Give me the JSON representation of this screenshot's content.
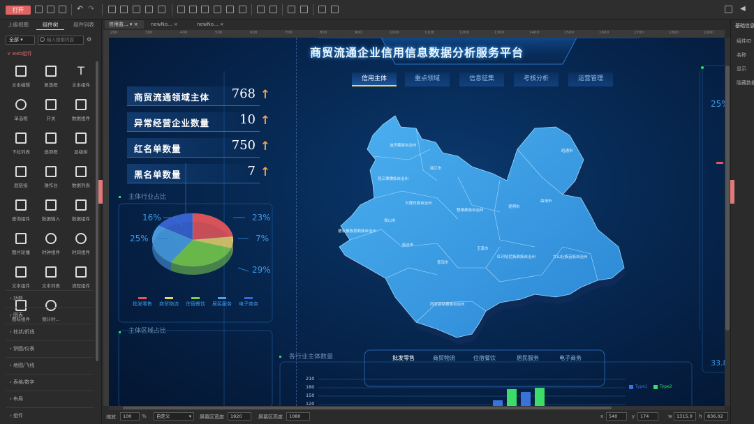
{
  "toolbar": {
    "open_label": "打开"
  },
  "left_panel": {
    "tabs": [
      "上级视图",
      "组件树",
      "组件列表"
    ],
    "filter_select": "全部",
    "search_placeholder": "输入搜索内容",
    "group_title": "web组件",
    "widgets": [
      "文本编辑",
      "复选框",
      "文本组件",
      "单选框",
      "开关",
      "数据组件",
      "下拉列表",
      "选项框",
      "层级树",
      "超链接",
      "操作台",
      "数据列表",
      "查询组件",
      "数据输入",
      "数据组件",
      "图片轮播",
      "时钟组件",
      "时间组件",
      "文本组件",
      "文本列表",
      "流程组件",
      "图标组件",
      "倒计时..."
    ],
    "categories": [
      "功能",
      "图表",
      "柱状/折线",
      "饼图/仪表",
      "地图/飞线",
      "表格/数字",
      "布局",
      "组件"
    ]
  },
  "doc_tabs": [
    "信用监...",
    "newNo...",
    "newNo..."
  ],
  "ruler_ticks": [
    "200",
    "300",
    "400",
    "500",
    "600",
    "700",
    "800",
    "900",
    "1000",
    "1100",
    "1200",
    "1300",
    "1400",
    "1500",
    "1600",
    "1700",
    "1800",
    "1900"
  ],
  "right_panel": {
    "title": "基础信息",
    "items": [
      "组件ID",
      "名称",
      "显示",
      "隐藏数据"
    ]
  },
  "dashboard": {
    "title": "商贸流通企业信用信息数据分析服务平台",
    "nav": [
      "信用主体",
      "重点领域",
      "信息征集",
      "考核分析",
      "运营管理"
    ],
    "kpis": [
      {
        "label": "商贸流通领域主体",
        "value": "768"
      },
      {
        "label": "异常经营企业数量",
        "value": "10"
      },
      {
        "label": "红名单数量",
        "value": "750"
      },
      {
        "label": "黑名单数量",
        "value": "7"
      }
    ],
    "kpi_arrow": "↑",
    "pie_section_title": "主体行业占比",
    "pie_labels": [
      "16%",
      "23%",
      "25%",
      "7%",
      "29%"
    ],
    "legend": [
      "批发零售",
      "商贸物流",
      "住宿餐饮",
      "居民服务",
      "电子商务"
    ],
    "lower_section_title": "主体区域占比",
    "bottom_section_title": "各行业主体数量",
    "bottom_tabs": [
      "批发零售",
      "商贸物流",
      "住宿餐饮",
      "居民服务",
      "电子商务"
    ],
    "y_ticks": [
      "210",
      "180",
      "150",
      "120"
    ],
    "bar_legend": [
      "Type1",
      "Type2"
    ],
    "right_values": [
      "25%",
      "33.8"
    ],
    "cities": [
      "迪庆藏族自治州",
      "丽江市",
      "怒江傈僳族自治州",
      "大理白族自治州",
      "楚雄彝族自治州",
      "昆明市",
      "保山市",
      "德宏傣族景颇族自治州",
      "临沧市",
      "普洱市",
      "玉溪市",
      "红河哈尼族彝族自治州",
      "文山壮族苗族自治州",
      "曲靖市",
      "昭通市",
      "西双版纳傣族自治州"
    ]
  },
  "chart_data": {
    "type": "pie",
    "values": [
      23,
      7,
      29,
      25,
      16
    ],
    "labels": [
      "23%",
      "7%",
      "29%",
      "25%",
      "16%"
    ],
    "colors": [
      "#e8565a",
      "#e9d36a",
      "#7bd14a",
      "#4aa3e8",
      "#3a66d8"
    ],
    "legend": [
      "批发零售",
      "商贸物流",
      "住宿餐饮",
      "居民服务",
      "电子商务"
    ]
  },
  "status": {
    "zoom_label": "缩放",
    "zoom_value": "100",
    "zoom_unit": "%",
    "mode_value": "自定义",
    "width_label": "屏幕区宽度",
    "width_value": "1920",
    "height_label": "屏幕区高度",
    "height_value": "1080",
    "x_label": "x",
    "x_value": "540",
    "y_label": "y",
    "y_value": "174",
    "w_label": "w",
    "w_value": "1315.0",
    "h_label": "h",
    "h_value": "836.02"
  },
  "colors": {
    "accent": "#e06464",
    "kpi_arrow": "#f3a24b",
    "title": "#ffffff",
    "nav_active_underline": "#e9d36a"
  }
}
